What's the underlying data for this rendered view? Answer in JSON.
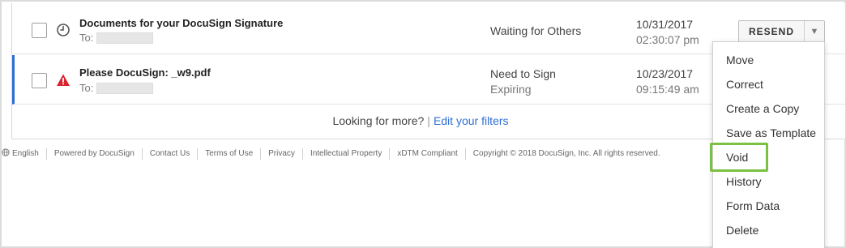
{
  "envelopes": [
    {
      "subject": "Documents for your DocuSign Signature",
      "to_label": "To:",
      "status": "Waiting for Others",
      "status_sub": "",
      "date": "10/31/2017",
      "time": "02:30:07 pm",
      "icon": "clock-icon"
    },
    {
      "subject": "Please DocuSign: _w9.pdf",
      "to_label": "To:",
      "status": "Need to Sign",
      "status_sub": "Expiring",
      "date": "10/23/2017",
      "time": "09:15:49 am",
      "icon": "warning-icon"
    }
  ],
  "resend": {
    "label": "RESEND",
    "caret": "▼"
  },
  "more": {
    "text": "Looking for more?",
    "separator": "|",
    "link": "Edit your filters"
  },
  "footer": {
    "items": [
      "English",
      "Powered by DocuSign",
      "Contact Us",
      "Terms of Use",
      "Privacy",
      "Intellectual Property",
      "xDTM Compliant",
      "Copyright © 2018 DocuSign, Inc. All rights reserved."
    ]
  },
  "menu": {
    "items": [
      "Move",
      "Correct",
      "Create a Copy",
      "Save as Template",
      "Void",
      "History",
      "Form Data",
      "Delete"
    ],
    "highlighted": "Void"
  },
  "colors": {
    "accent_blue": "#2e6ed3",
    "highlight_green": "#7ac143",
    "warning_red": "#d9232e"
  }
}
